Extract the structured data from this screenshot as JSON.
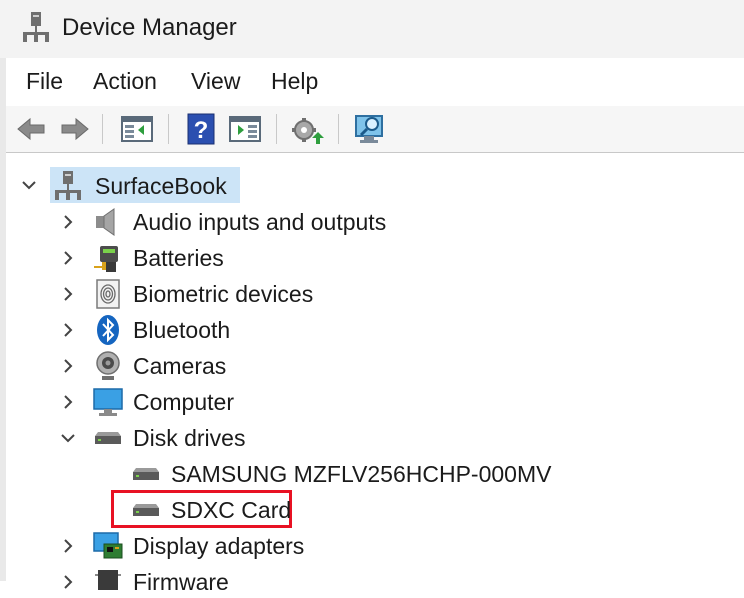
{
  "window": {
    "title": "Device Manager",
    "icon": "computer-tree-icon"
  },
  "menu": {
    "file": "File",
    "action": "Action",
    "view": "View",
    "help": "Help"
  },
  "toolbar": {
    "buttons": [
      "back-arrow-icon",
      "forward-arrow-icon",
      "show-hide-console-tree-icon",
      "help-icon",
      "show-action-pane-icon",
      "update-driver-icon",
      "scan-hardware-icon"
    ]
  },
  "tree": {
    "root": {
      "label": "SurfaceBook",
      "expanded": true,
      "selected": true
    },
    "categories": {
      "audio": {
        "label": "Audio inputs and outputs",
        "expanded": false
      },
      "batteries": {
        "label": "Batteries",
        "expanded": false
      },
      "biometric": {
        "label": "Biometric devices",
        "expanded": false
      },
      "bluetooth": {
        "label": "Bluetooth",
        "expanded": false
      },
      "cameras": {
        "label": "Cameras",
        "expanded": false
      },
      "computer": {
        "label": "Computer",
        "expanded": false
      },
      "disk_drives": {
        "label": "Disk drives",
        "expanded": true,
        "children": {
          "samsung": {
            "label": "SAMSUNG MZFLV256HCHP-000MV"
          },
          "sdxc": {
            "label": "SDXC Card",
            "highlight_color": "#e81123"
          }
        }
      },
      "display": {
        "label": "Display adapters",
        "expanded": false
      },
      "firmware": {
        "label": "Firmware",
        "expanded": false
      }
    }
  },
  "colors": {
    "selection": "#cce4f7",
    "highlight_border": "#e81123",
    "accent": "#0078d4"
  }
}
